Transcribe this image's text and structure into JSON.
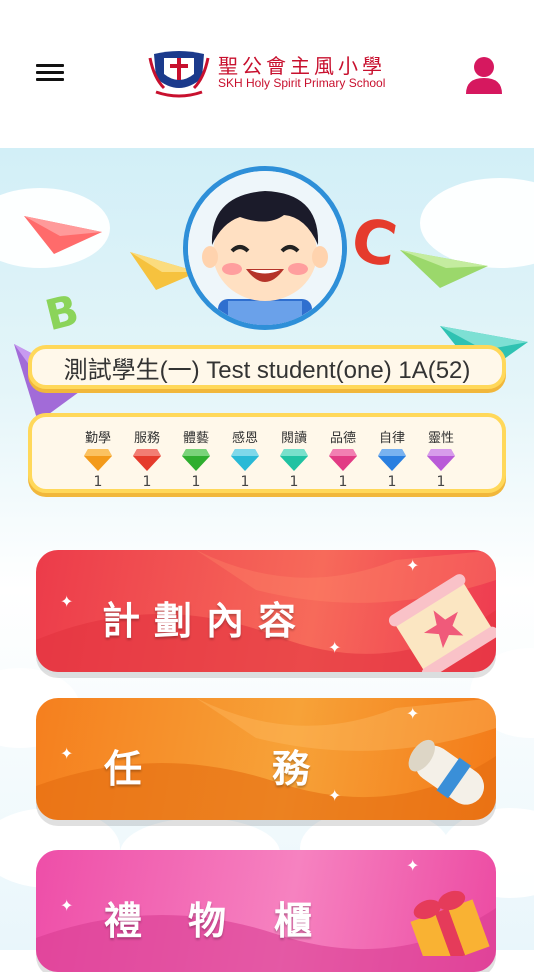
{
  "header": {
    "school_name_zh": "聖公會主風小學",
    "school_name_en": "SKH Holy Spirit Primary School"
  },
  "profile": {
    "student_name": "測試學生(一) Test student(one) 1A(52)"
  },
  "gems": [
    {
      "label": "勤學",
      "count": "1",
      "color": "#f39a1a"
    },
    {
      "label": "服務",
      "count": "1",
      "color": "#e53b2c"
    },
    {
      "label": "體藝",
      "count": "1",
      "color": "#2fae2f"
    },
    {
      "label": "感恩",
      "count": "1",
      "color": "#29b9d6"
    },
    {
      "label": "閱讀",
      "count": "1",
      "color": "#20c2a2"
    },
    {
      "label": "品德",
      "count": "1",
      "color": "#e23b84"
    },
    {
      "label": "自律",
      "count": "1",
      "color": "#2a7fe0"
    },
    {
      "label": "靈性",
      "count": "1",
      "color": "#b95ad8"
    }
  ],
  "menu_cards": {
    "plan": "計劃內容",
    "task_1": "任",
    "task_2": "務",
    "gift_1": "禮",
    "gift_2": "物",
    "gift_3": "櫃"
  },
  "colors": {
    "brand": "#c8102e",
    "user_icon": "#d6185f",
    "card_plan": "#f0444f",
    "card_task": "#f58a1f",
    "card_gift": "#f05aa8"
  }
}
